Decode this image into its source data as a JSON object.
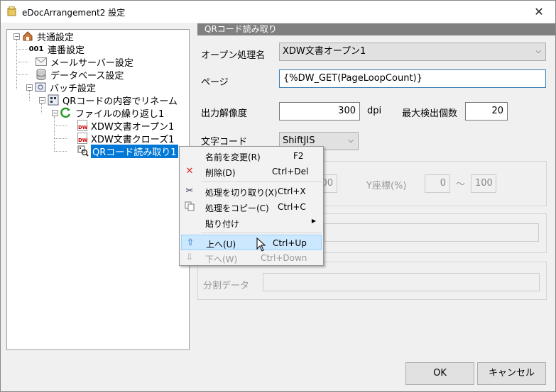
{
  "window": {
    "title": "eDocArrangement2 設定",
    "close_glyph": "✕"
  },
  "tree": {
    "common": "共通設定",
    "serial": "連番設定",
    "serial_icon_text": "001",
    "mail": "メールサーバー設定",
    "database": "データベース設定",
    "batch": "バッチ設定",
    "qr_rename": "QRコードの内容でリネーム",
    "file_loop": "ファイルの繰り返し1",
    "xdw_open": "XDW文書オープン1",
    "xdw_close": "XDW文書クローズ1",
    "qr_read": "QRコード読み取り1",
    "dw_icon_text": "DW"
  },
  "panel": {
    "header": "QRコード読み取り",
    "open_process_label": "オープン処理名",
    "open_process_value": "XDW文書オープン1",
    "page_label": "ページ",
    "page_value": "{%DW_GET(PageLoopCount)}",
    "resolution_label": "出力解像度",
    "resolution_value": "300",
    "dpi_unit": "dpi",
    "max_detect_label": "最大検出個数",
    "max_detect_value": "20",
    "charset_label": "文字コード",
    "charset_value": "ShiftJIS",
    "x_partial_value": "00",
    "y_coord_label": "Y座標(%)",
    "y_from": "0",
    "tilde": "〜",
    "y_to": "100",
    "split_data_label": "分割データ"
  },
  "context_menu": {
    "items": [
      {
        "label": "名前を変更(R)",
        "shortcut": "F2",
        "icon": ""
      },
      {
        "label": "削除(D)",
        "shortcut": "Ctrl+Del",
        "icon": "delete-icon"
      },
      {
        "label": "処理を切り取り(X)",
        "shortcut": "Ctrl+X",
        "icon": "cut-icon"
      },
      {
        "label": "処理をコピー(C)",
        "shortcut": "Ctrl+C",
        "icon": "copy-icon"
      },
      {
        "label": "貼り付け",
        "shortcut": "",
        "icon": ""
      },
      {
        "label": "上へ(U)",
        "shortcut": "Ctrl+Up",
        "icon": "arrow-up-icon"
      },
      {
        "label": "下へ(W)",
        "shortcut": "Ctrl+Down",
        "icon": "arrow-down-icon"
      }
    ]
  },
  "buttons": {
    "ok": "OK",
    "cancel": "キャンセル"
  }
}
